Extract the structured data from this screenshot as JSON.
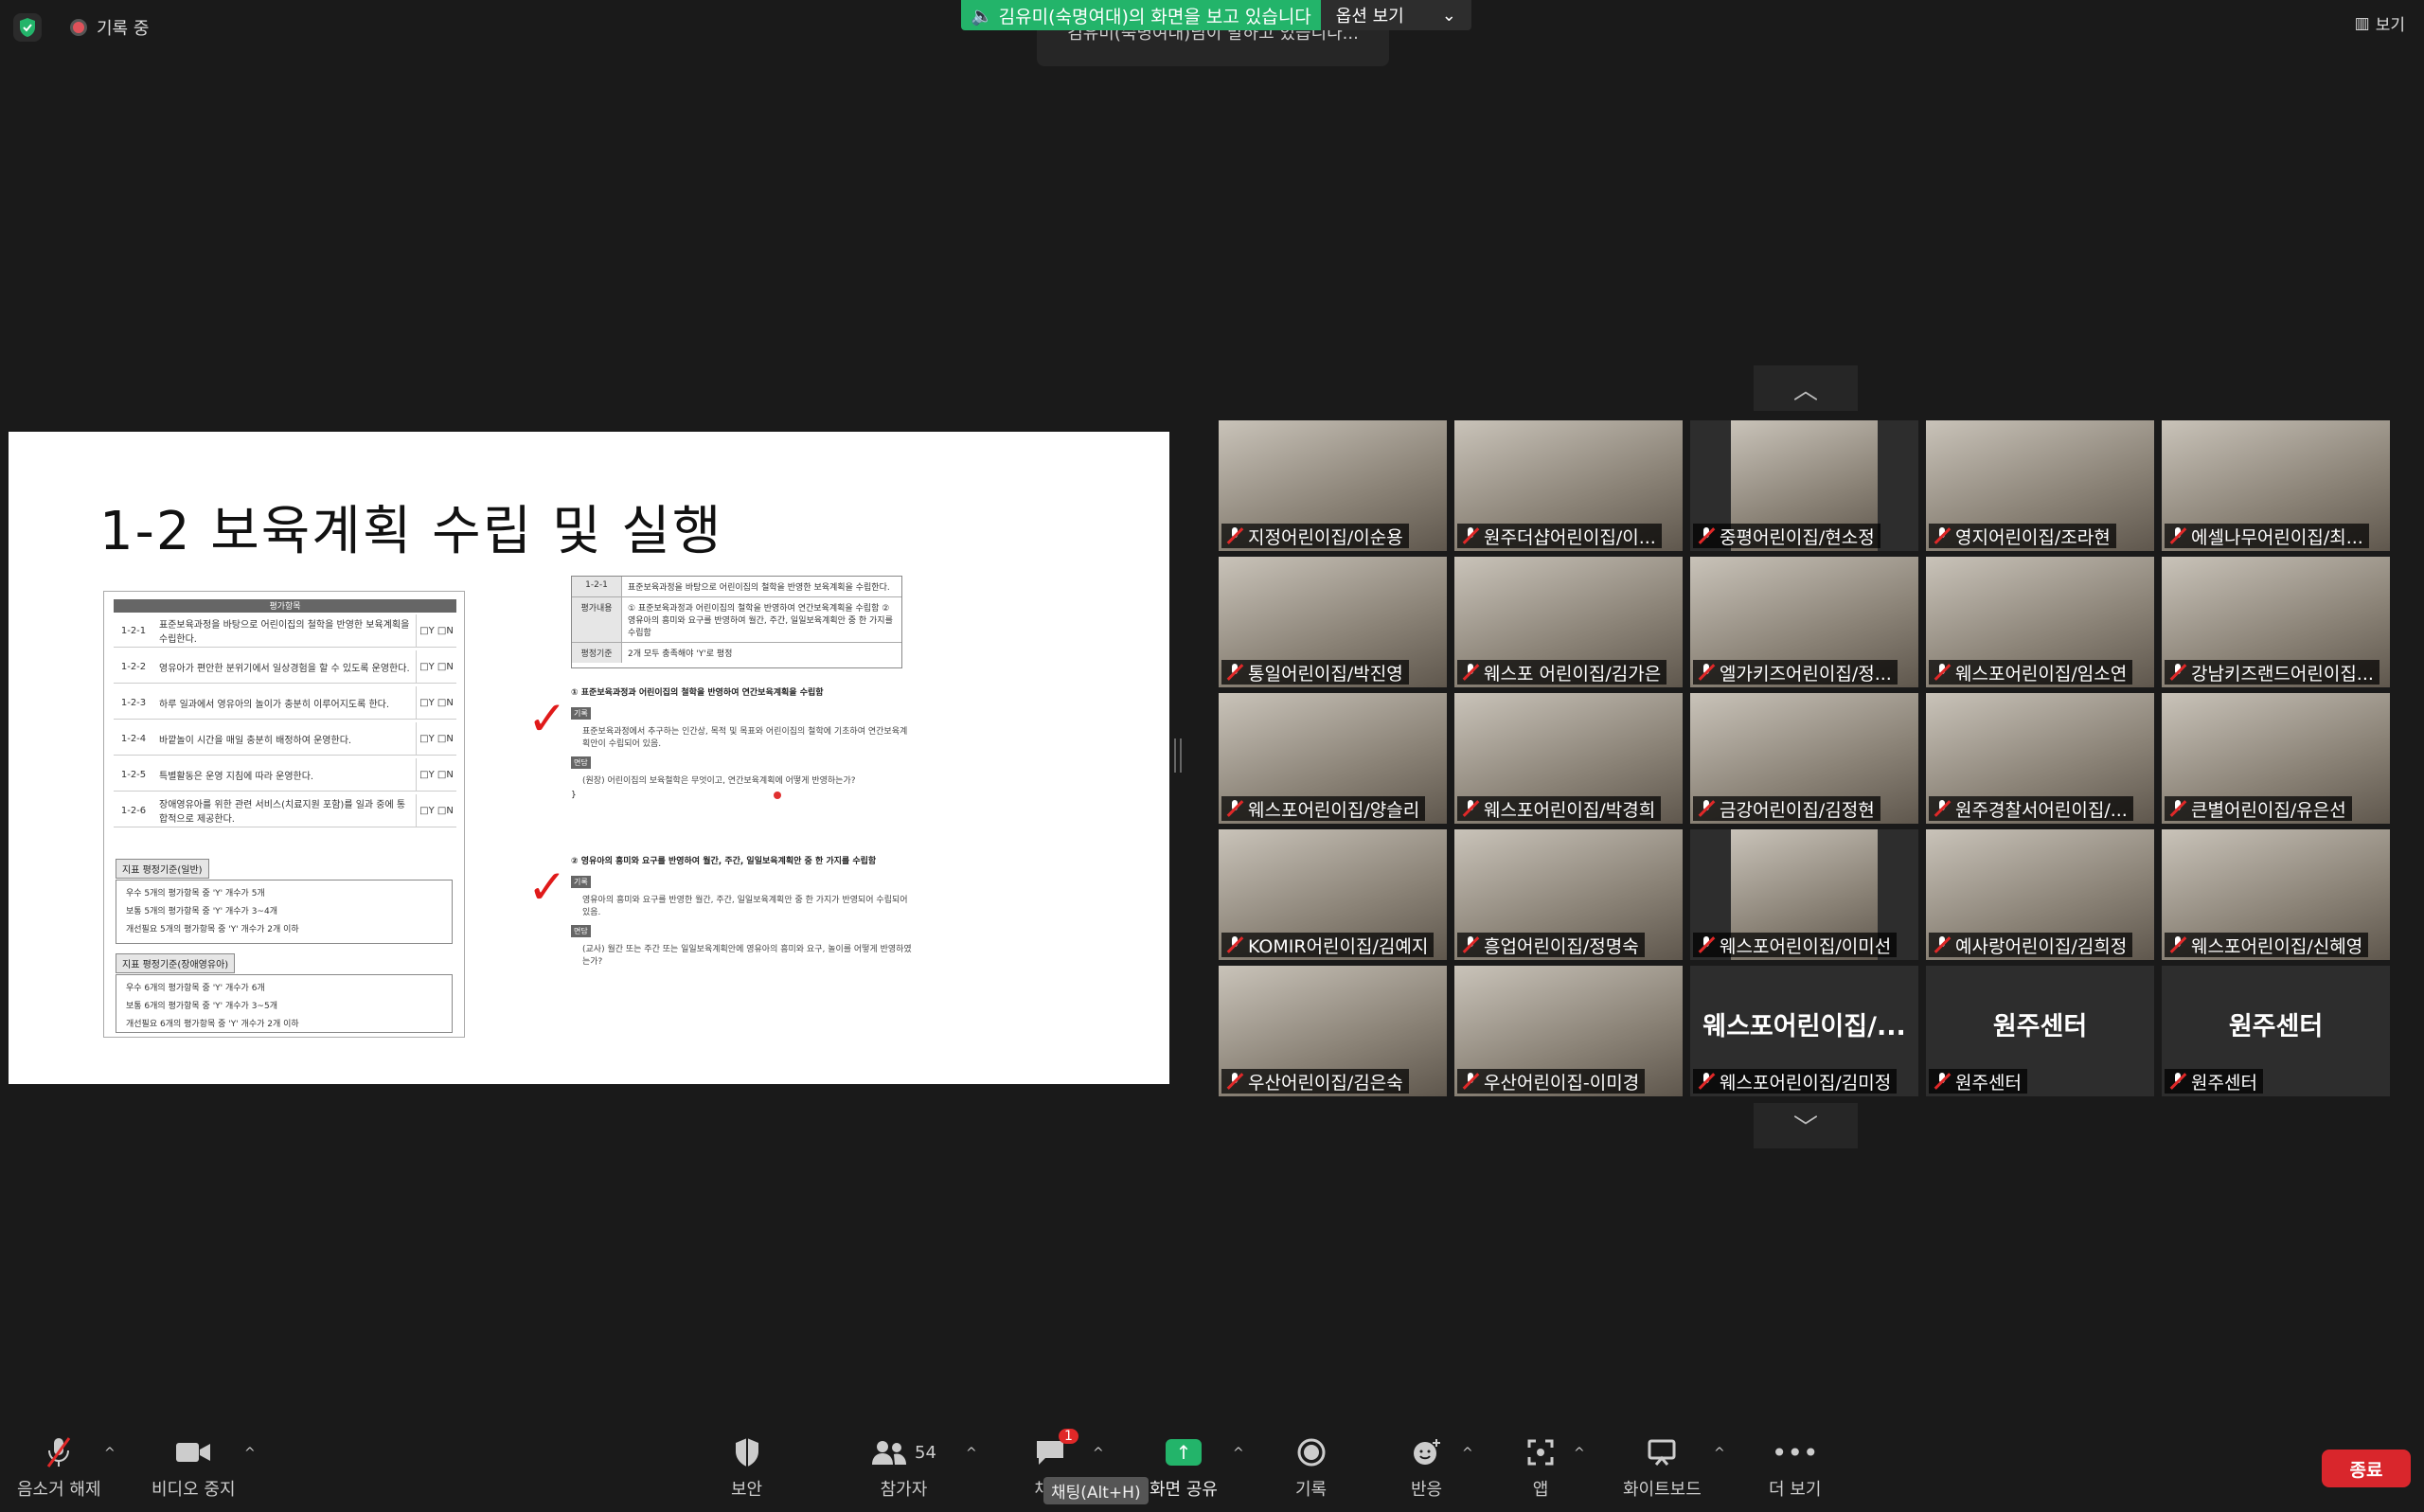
{
  "top": {
    "recording_label": "기록 중",
    "share_banner": "김유미(숙명여대)의 화면을 보고 있습니다",
    "share_options": "옵션 보기",
    "share_tip": "김유미(숙명여대)님이 말하고 있습니다...",
    "view_label": "보기"
  },
  "slide": {
    "title": "1-2 보육계획 수립 및 실행",
    "left_header": "평가항목",
    "left_rows": [
      {
        "code": "1-2-1",
        "text": "표준보육과정을 바탕으로 어린이집의 철학을 반영한 보육계획을 수립한다.",
        "yn": "□Y □N"
      },
      {
        "code": "1-2-2",
        "text": "영유아가 편안한 분위기에서 일상경험을 할 수 있도록 운영한다.",
        "yn": "□Y □N"
      },
      {
        "code": "1-2-3",
        "text": "하루 일과에서 영유아의 놀이가 충분히 이루어지도록 한다.",
        "yn": "□Y □N"
      },
      {
        "code": "1-2-4",
        "text": "바깥놀이 시간을 매일 충분히 배정하여 운영한다.",
        "yn": "□Y □N"
      },
      {
        "code": "1-2-5",
        "text": "특별활동은 운영 지침에 따라 운영한다.",
        "yn": "□Y □N"
      },
      {
        "code": "1-2-6",
        "text": "장애영유아를 위한 관련 서비스(치료지원 포함)를 일과 중에 통합적으로 제공한다.",
        "yn": "□Y □N"
      }
    ],
    "criteria_general_tag": "지표 평정기준(일반)",
    "criteria_general": [
      "우수 5개의 평가항목 중 'Y' 개수가 5개",
      "보통 5개의 평가항목 중 'Y' 개수가 3~4개",
      "개선필요 5개의 평가항목 중 'Y' 개수가 2개 이하"
    ],
    "criteria_disabled_tag": "지표 평정기준(장애영유아)",
    "criteria_disabled": [
      "우수 6개의 평가항목 중 'Y' 개수가 6개",
      "보통 6개의 평가항목 중 'Y' 개수가 3~5개",
      "개선필요 6개의 평가항목 중 'Y' 개수가 2개 이하"
    ],
    "right_table": [
      {
        "k": "1-2-1",
        "v": "표준보육과정을 바탕으로 어린이집의 철학을 반영한 보육계획을 수립한다."
      },
      {
        "k": "평가내용",
        "v": "① 표준보육과정과 어린이집의 철학을 반영하여 연간보육계획을 수립함 ② 영유아의 흥미와 요구를 반영하여 월간, 주간, 일일보육계획안 중 한 가지를 수립함"
      },
      {
        "k": "평정기준",
        "v": "2개 모두 충족해야 'Y'로 평정"
      }
    ],
    "sect1_heading": "① 표준보육과정과 어린이집의 철학을 반영하여 연간보육계획을 수립함",
    "sect1_tag1": "기록",
    "sect1_text1": "표준보육과정에서 추구하는 인간상, 목적 및 목표와 어린이집의 철학에 기초하여 연간보육계획안이 수립되어 있음.",
    "sect1_tag2": "면담",
    "sect1_text2": "(원장) 어린이집의 보육철학은 무엇이고, 연간보육계획에 어떻게 반영하는가?",
    "sect2_heading": "② 영유아의 흥미와 요구를 반영하여 월간, 주간, 일일보육계획안 중 한 가지를 수립함",
    "sect2_tag1": "기록",
    "sect2_text1": "영유아의 흥미와 요구를 반영한 월간, 주간, 일일보육계획안 중 한 가지가 반영되어 수립되어 있음.",
    "sect2_tag2": "면담",
    "sect2_text2": "(교사) 월간 또는 주간 또는 일일보육계획안에 영유아의 흥미와 요구, 놀이를 어떻게 반영하였는가?"
  },
  "participants": [
    {
      "name": "지정어린이집/이순용",
      "video": true
    },
    {
      "name": "원주더샵어린이집/이...",
      "video": true
    },
    {
      "name": "중평어린이집/현소정",
      "video": true,
      "narrow": true
    },
    {
      "name": "영지어린이집/조라현",
      "video": true
    },
    {
      "name": "에셀나무어린이집/최...",
      "video": true
    },
    {
      "name": "통일어린이집/박진영",
      "video": true
    },
    {
      "name": "웨스포 어린이집/김가은",
      "video": true
    },
    {
      "name": "엘가키즈어린이집/정...",
      "video": true
    },
    {
      "name": "웨스포어린이집/임소연",
      "video": true
    },
    {
      "name": "강남키즈랜드어린이집...",
      "video": true
    },
    {
      "name": "웨스포어린이집/양슬리",
      "video": true
    },
    {
      "name": "웨스포어린이집/박경희",
      "video": true
    },
    {
      "name": "금강어린이집/김정현",
      "video": true
    },
    {
      "name": "원주경찰서어린이집/...",
      "video": true
    },
    {
      "name": "큰별어린이집/유은선",
      "video": true
    },
    {
      "name": "KOMIR어린이집/김예지",
      "video": true
    },
    {
      "name": "흥업어린이집/정명숙",
      "video": true
    },
    {
      "name": "웨스포어린이집/이미선",
      "video": true,
      "narrow": true
    },
    {
      "name": "예사랑어린이집/김희정",
      "video": true
    },
    {
      "name": "웨스포어린이집/신혜영",
      "video": true
    },
    {
      "name": "우산어린이집/김은숙",
      "video": true
    },
    {
      "name": "우산어린이집-이미경",
      "video": true
    },
    {
      "name": "웨스포어린이집/김미정",
      "video": false,
      "big": "웨스포어린이집/..."
    },
    {
      "name": "원주센터",
      "video": false,
      "big": "원주센터"
    },
    {
      "name": "원주센터",
      "video": false,
      "big": "원주센터"
    }
  ],
  "toolbar": {
    "unmute": "음소거 해제",
    "video": "비디오 중지",
    "security": "보안",
    "participants": "참가자",
    "participants_count": "54",
    "chat": "채팅",
    "chat_badge": "1",
    "chat_tooltip": "채팅(Alt+H)",
    "share": "화면 공유",
    "record": "기록",
    "reactions": "반응",
    "apps": "앱",
    "whiteboard": "화이트보드",
    "more": "더 보기",
    "end": "종료"
  }
}
